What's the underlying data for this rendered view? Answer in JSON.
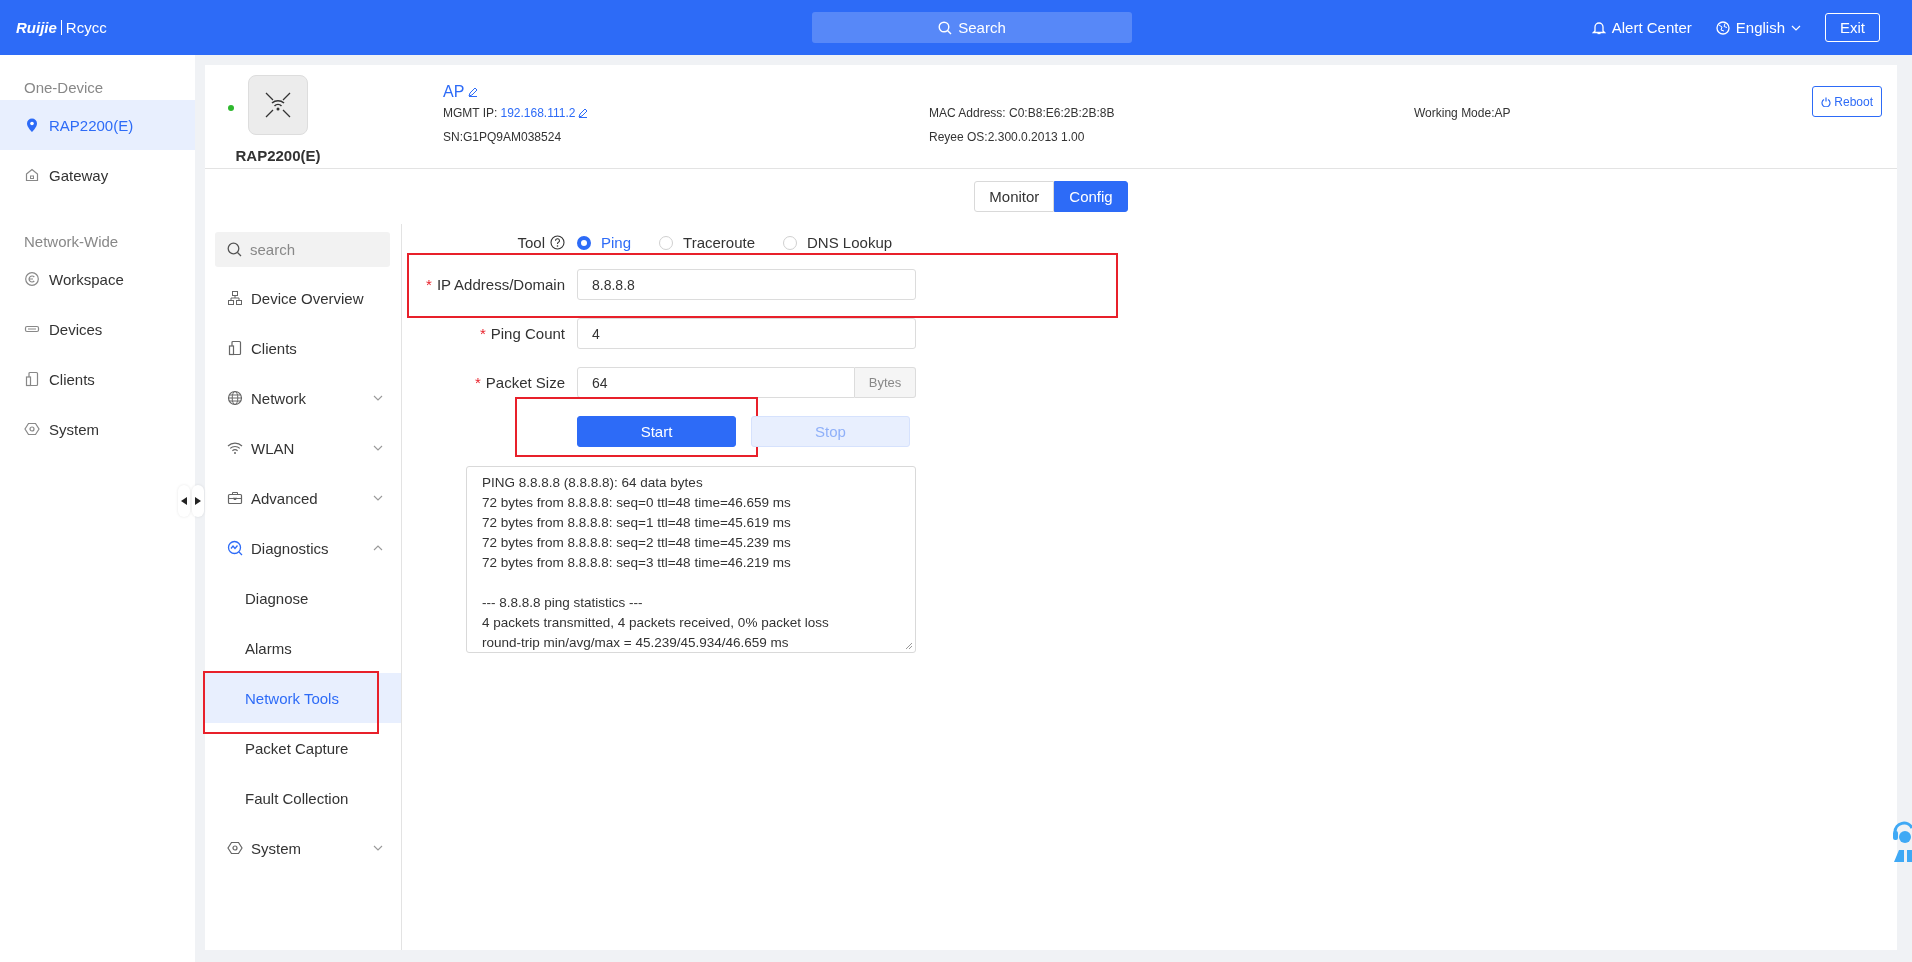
{
  "top_bar": {
    "logo": {
      "brand": "Ruijie",
      "product": "Rcycc"
    },
    "search": {
      "placeholder": "Search"
    },
    "alert_center": "Alert Center",
    "language": "English",
    "exit": "Exit"
  },
  "sidebar": {
    "sections": [
      {
        "heading": "One-Device",
        "items": [
          {
            "label": "RAP2200(E)",
            "selected": true
          },
          {
            "label": "Gateway",
            "selected": false
          }
        ]
      },
      {
        "heading": "Network-Wide",
        "items": [
          {
            "label": "Workspace",
            "selected": false
          },
          {
            "label": "Devices",
            "selected": false
          },
          {
            "label": "Clients",
            "selected": false
          },
          {
            "label": "System",
            "selected": false
          }
        ]
      }
    ]
  },
  "device": {
    "online": true,
    "model": "RAP2200(E)",
    "name": "AP",
    "mgmt_ip_label": "MGMT IP:",
    "mgmt_ip": "192.168.111.2",
    "sn": "SN:G1PQ9AM038524",
    "mac": "MAC Address: C0:B8:E6:2B:2B:8B",
    "os": "Reyee OS:2.300.0.2013 1.00",
    "mode": "Working Mode:AP",
    "reboot": "Reboot"
  },
  "view_tabs": [
    {
      "label": "Monitor",
      "selected": false
    },
    {
      "label": "Config",
      "selected": true
    }
  ],
  "menu": {
    "search": {
      "placeholder": "search"
    },
    "items": [
      {
        "label": "Device Overview",
        "selected": false
      },
      {
        "label": "Clients",
        "selected": false
      },
      {
        "label": "Network",
        "selected": false,
        "expanded": false
      },
      {
        "label": "WLAN",
        "selected": false,
        "expanded": false
      },
      {
        "label": "Advanced",
        "selected": false,
        "expanded": false
      },
      {
        "label": "Diagnostics",
        "selected": false,
        "expanded": true,
        "children": [
          {
            "label": "Diagnose",
            "selected": false
          },
          {
            "label": "Alarms",
            "selected": false
          },
          {
            "label": "Network Tools",
            "selected": true,
            "highlighted": true
          },
          {
            "label": "Packet Capture",
            "selected": false
          },
          {
            "label": "Fault Collection",
            "selected": false
          }
        ]
      },
      {
        "label": "System",
        "selected": false,
        "expanded": false
      }
    ]
  },
  "form": {
    "tool": {
      "label": "Tool",
      "options": [
        {
          "label": "Ping",
          "selected": true
        },
        {
          "label": "Traceroute",
          "selected": false
        },
        {
          "label": "DNS Lookup",
          "selected": false
        }
      ]
    },
    "fields": [
      {
        "marker": "*",
        "label": "IP Address/Domain",
        "value": "8.8.8.8",
        "highlighted": true
      },
      {
        "marker": "*",
        "label": "Ping Count",
        "value": "4"
      },
      {
        "marker": "*",
        "label": "Packet Size",
        "value": "64",
        "suffix": "Bytes"
      }
    ],
    "buttons": [
      {
        "label": "Start",
        "kind": "primary",
        "highlighted": true
      },
      {
        "label": "Stop",
        "kind": "disabled"
      }
    ],
    "output": "PING 8.8.8.8 (8.8.8.8): 64 data bytes\n72 bytes from 8.8.8.8: seq=0 ttl=48 time=46.659 ms\n72 bytes from 8.8.8.8: seq=1 ttl=48 time=45.619 ms\n72 bytes from 8.8.8.8: seq=2 ttl=48 time=45.239 ms\n72 bytes from 8.8.8.8: seq=3 ttl=48 time=46.219 ms\n\n--- 8.8.8.8 ping statistics ---\n4 packets transmitted, 4 packets received, 0% packet loss\nround-trip min/avg/max = 45.239/45.934/46.659 ms"
  }
}
